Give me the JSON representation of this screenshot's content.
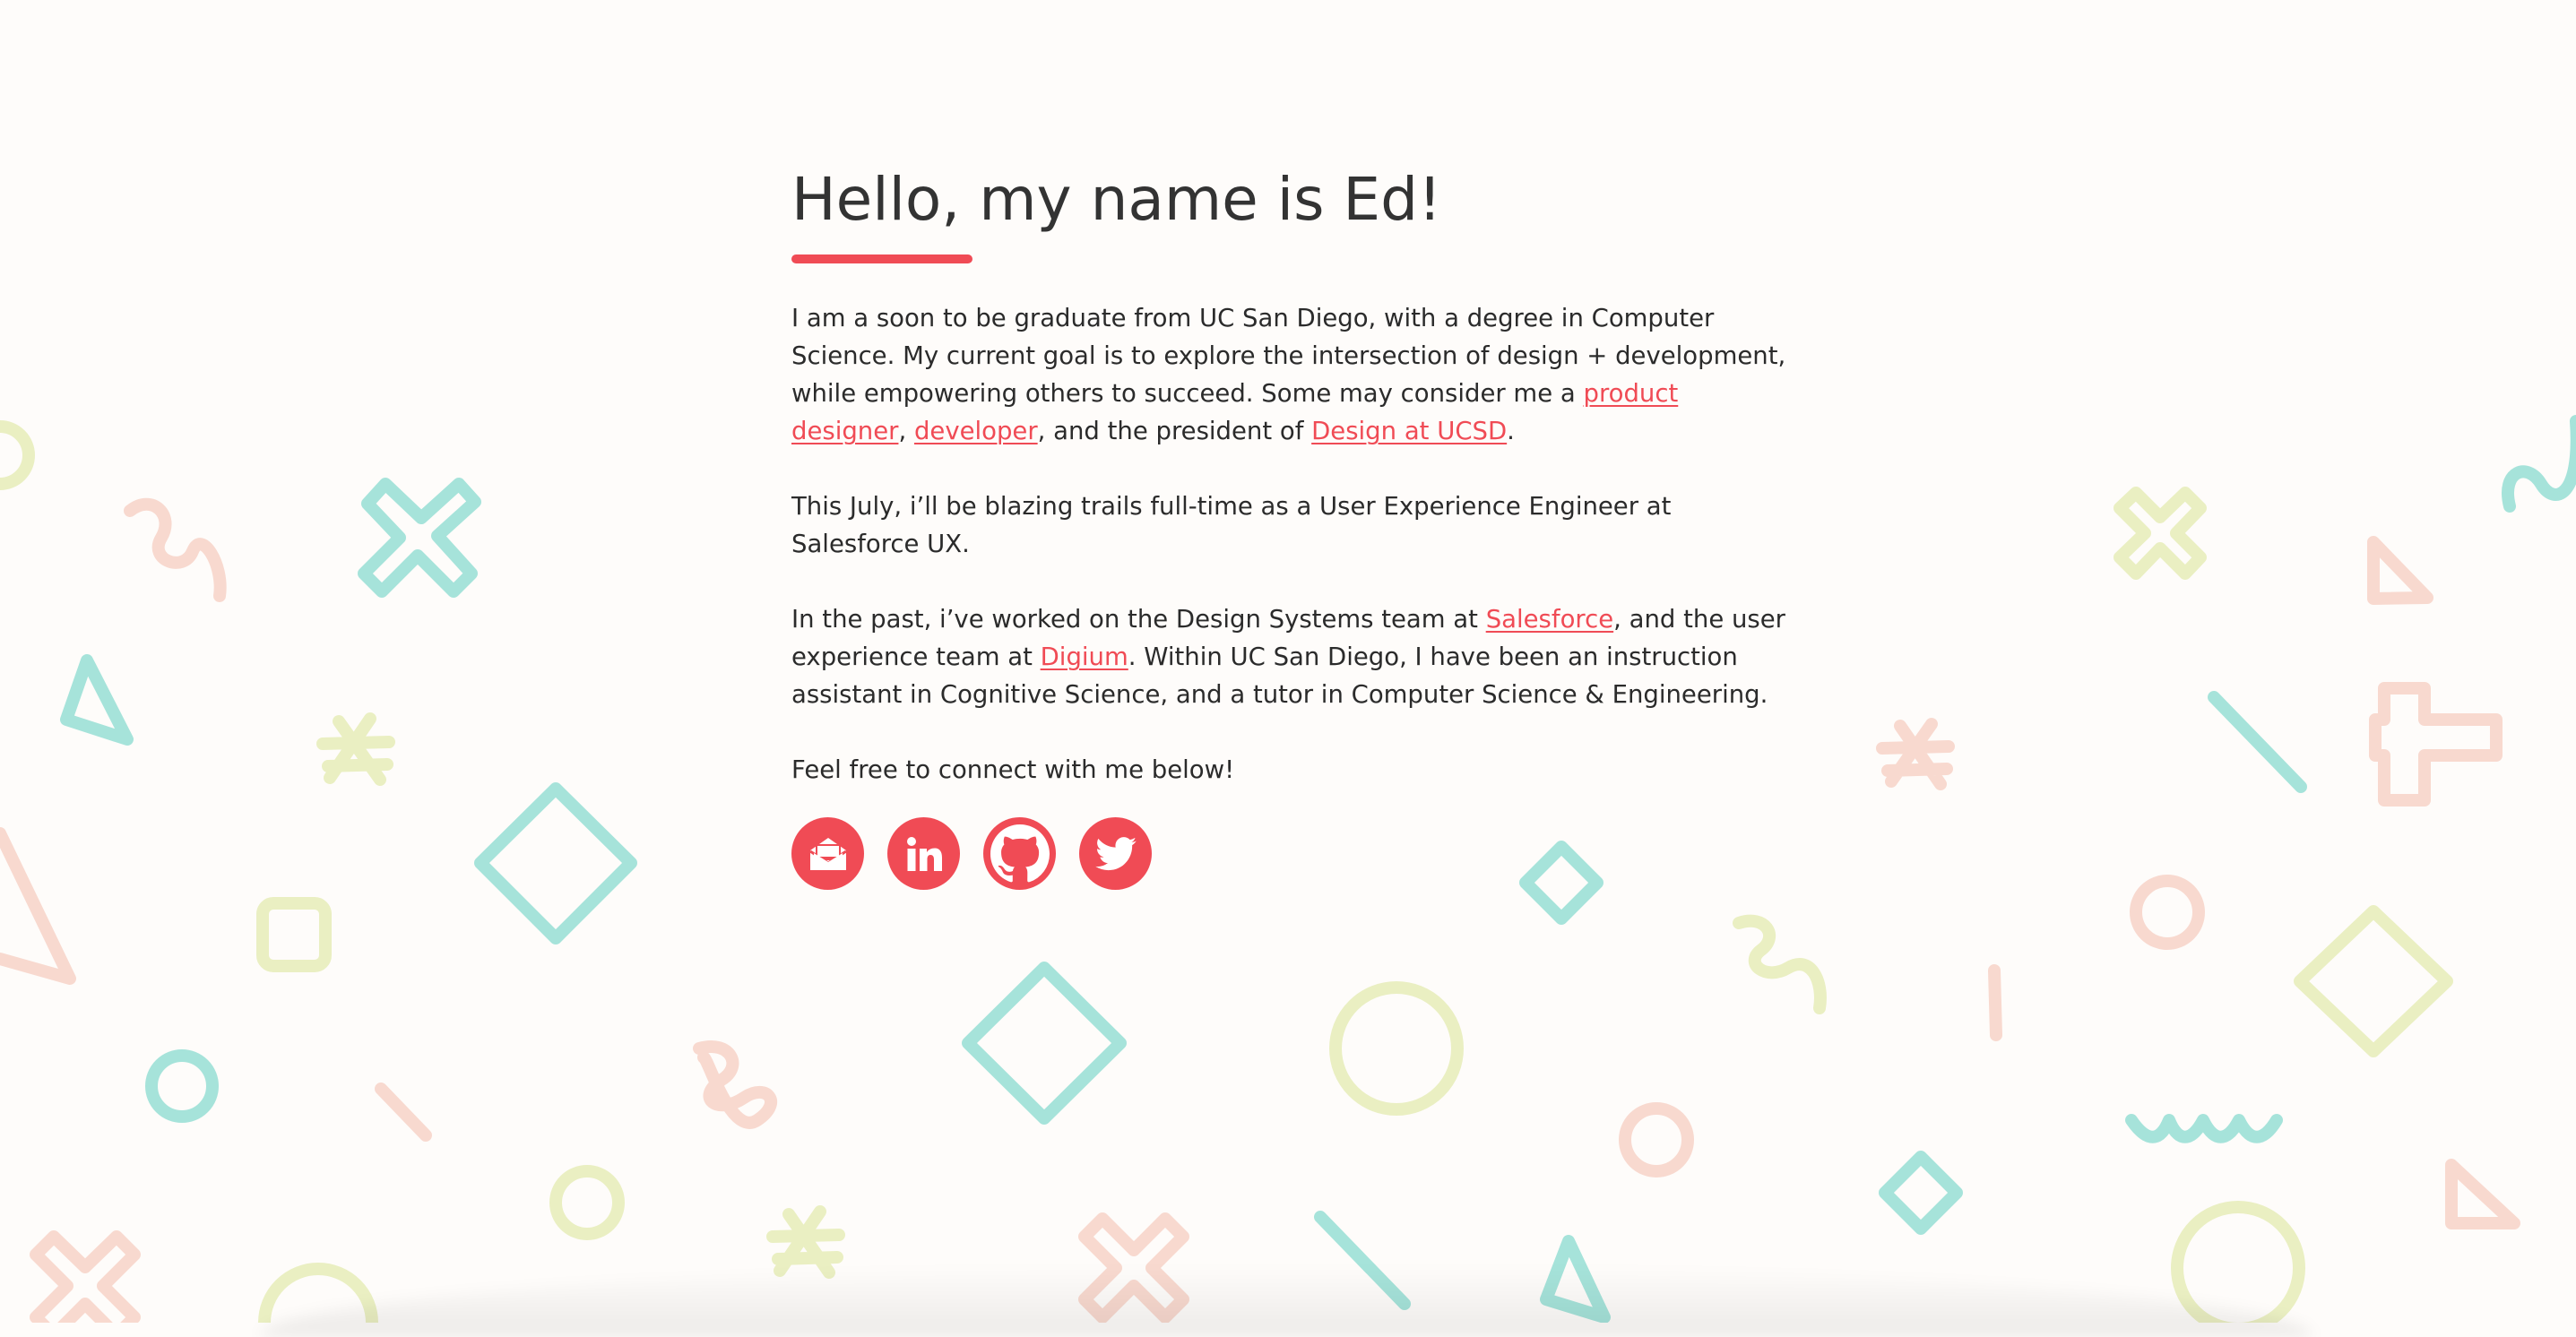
{
  "heading": "Hello, my name is Ed!",
  "paragraphs": {
    "p1": {
      "t1": "I am a soon to be graduate from UC San Diego, with a degree in Computer Science. My current goal is to explore the intersection of design + development, while empowering others to succeed. Some may consider me a ",
      "link1": "product designer",
      "t2": ", ",
      "link2": "developer",
      "t3": ", and the president of ",
      "link3": "Design at UCSD",
      "t4": "."
    },
    "p2": {
      "t1": "This July, i’ll be blazing trails full-time as a User Experience Engineer at Salesforce UX."
    },
    "p3": {
      "t1": "In the past, i’ve worked on the Design Systems team at ",
      "link1": "Salesforce",
      "t2": ", and the user experience team at ",
      "link2": "Digium",
      "t3": ". Within UC San Diego, I have been an instruction assistant in Cognitive Science, and a tutor in Computer Science & Engineering."
    },
    "p4": {
      "t1": "Feel free to connect with me below!"
    }
  },
  "social": [
    "email-icon",
    "linkedin-icon",
    "github-icon",
    "twitter-icon"
  ],
  "colors": {
    "accent": "#f04b55",
    "background": "#fefcfa",
    "text": "#2b2b2b",
    "shape_teal": "#a6e3da",
    "shape_yellow": "#eaefc2",
    "shape_pink": "#f8d9cf"
  }
}
